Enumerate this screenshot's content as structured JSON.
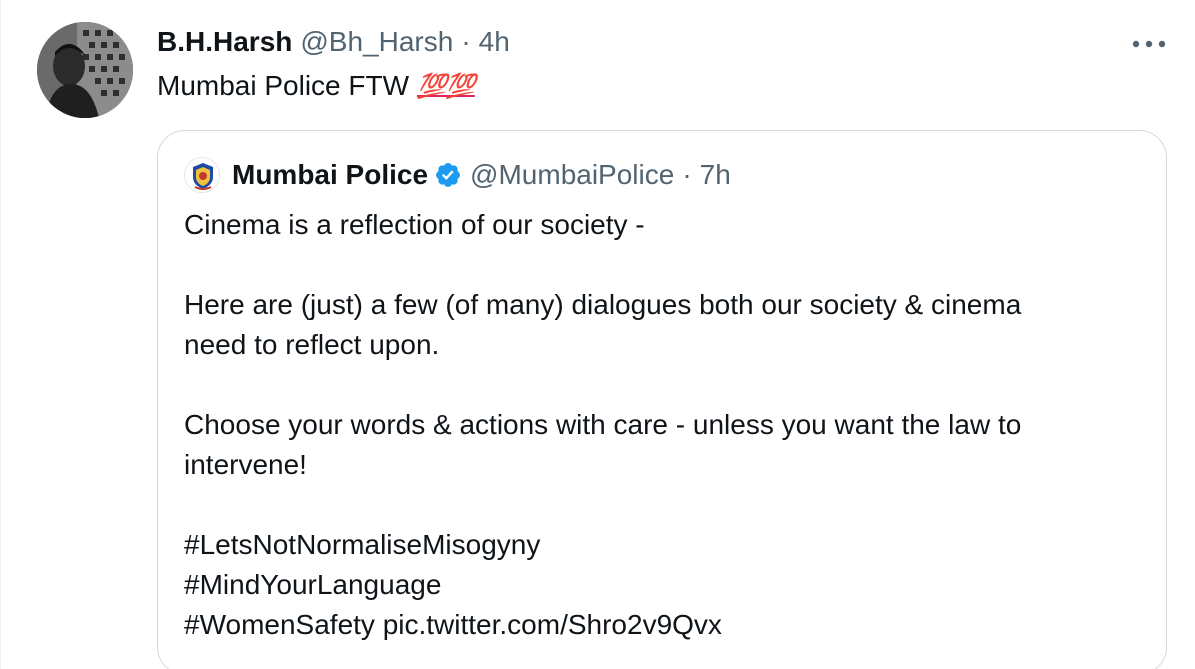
{
  "tweet": {
    "display_name": "B.H.Harsh",
    "handle": "@Bh_Harsh",
    "separator": "·",
    "time": "4h",
    "text": "Mumbai Police FTW",
    "emoji": "💯💯",
    "emoji_name": "hundred-points-emoji"
  },
  "quoted_tweet": {
    "display_name": "Mumbai Police",
    "verified": true,
    "handle": "@MumbaiPolice",
    "separator": "·",
    "time": "7h",
    "lines": [
      "Cinema is a reflection of our society -",
      "Here are (just) a few (of many) dialogues both our society & cinema",
      "need to reflect upon.",
      "Choose your words & actions with care - unless you want the law to",
      "intervene!",
      "#LetsNotNormaliseMisogyny",
      "#MindYourLanguage",
      "#WomenSafety pic.twitter.com/Shro2v9Qvx"
    ]
  },
  "icons": {
    "more": "more-horizontal-icon",
    "verified": "verified-badge-icon"
  },
  "colors": {
    "text": "#0f1419",
    "secondary": "#536471",
    "verified": "#1d9bf0",
    "border": "#cfd9de"
  }
}
